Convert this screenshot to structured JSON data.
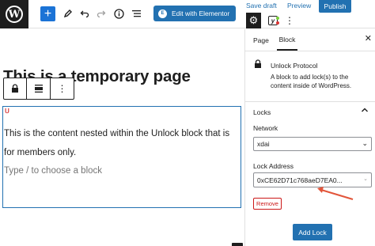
{
  "topbar": {
    "logo_letter": "W",
    "add_symbol": "+",
    "edit_elementor_label": "Edit with Elementor",
    "elementor_icon_letter": "E",
    "save_draft_label": "Save draft",
    "preview_label": "Preview",
    "publish_label": "Publish",
    "yoast_letter": "y"
  },
  "editor": {
    "page_title": "This is a temporary page",
    "paragraph_text": "This is the content nested within the Unlock block that is for members only.",
    "placeholder_text": "Type / to choose a block",
    "inserter_symbol": "+"
  },
  "sidebar": {
    "tabs": [
      {
        "label": "Page",
        "active": false
      },
      {
        "label": "Block",
        "active": true
      }
    ],
    "block_title": "Unlock Protocol",
    "block_description": "A block to add lock(s) to the content inside of WordPress.",
    "locks_panel_title": "Locks",
    "network_label": "Network",
    "network_value": "xdai",
    "lock_address_label": "Lock Address",
    "lock_address_value": "0xCE62D71c768aeD7EA0...",
    "remove_label": "Remove",
    "add_lock_label": "Add Lock"
  },
  "colors": {
    "accent": "#2271b1",
    "danger": "#cc1818",
    "dark": "#1e1e1e",
    "annotation_arrow": "#e2553a"
  }
}
